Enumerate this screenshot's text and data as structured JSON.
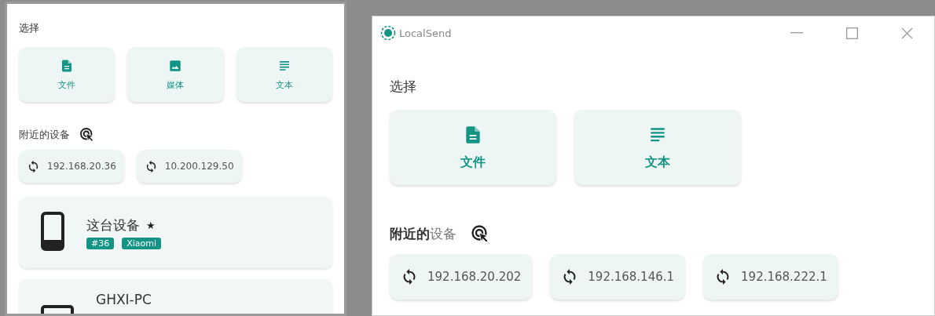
{
  "left_window": {
    "section_title": "选择",
    "options": [
      {
        "label": "文件",
        "kind": "file"
      },
      {
        "label": "媒体",
        "kind": "media"
      },
      {
        "label": "文本",
        "kind": "text"
      }
    ],
    "nearby_title": "附近的设备",
    "addresses": [
      "192.168.20.36",
      "10.200.129.50"
    ],
    "devices": [
      {
        "name": "这台设备",
        "favorite": "★",
        "kind": "phone",
        "tags": [
          "#36",
          "Xiaomi"
        ]
      },
      {
        "name": "GHXI-PC",
        "kind": "desktop"
      }
    ]
  },
  "right_window": {
    "title": "LocalSend",
    "section_title": "选择",
    "options": [
      {
        "label": "文件",
        "kind": "file"
      },
      {
        "label": "文本",
        "kind": "text"
      }
    ],
    "nearby_title": "**附近的**设备",
    "addresses": [
      "192.168.20.202",
      "192.168.146.1",
      "192.168.222.1"
    ]
  }
}
